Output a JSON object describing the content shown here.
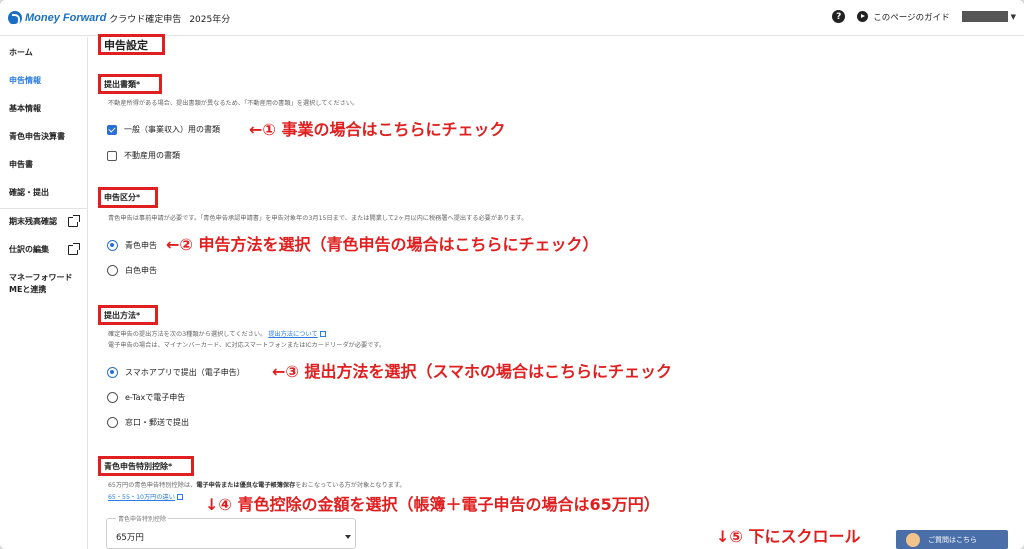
{
  "header": {
    "brand": "Money Forward",
    "product": "クラウド確定申告",
    "year": "2025年分",
    "help_icon_glyph": "?",
    "guide_label": "このページのガイド"
  },
  "sidebar": {
    "items": [
      {
        "label": "ホーム"
      },
      {
        "label": "申告情報"
      },
      {
        "label": "基本情報"
      },
      {
        "label": "青色申告決算書"
      },
      {
        "label": "申告書"
      },
      {
        "label": "確認・提出"
      },
      {
        "label": "期末残高確認"
      },
      {
        "label": "仕訳の編集"
      },
      {
        "label": "マネーフォワード\nMEと連携"
      }
    ]
  },
  "main": {
    "page_title": "申告設定",
    "sections": {
      "documents": {
        "title": "提出書類*",
        "desc": "不動産所得がある場合、提出書類が異なるため、「不動産用の書類」を選択してください。",
        "options": [
          {
            "label": "一般（事業収入）用の書類",
            "checked": true
          },
          {
            "label": "不動産用の書類",
            "checked": false
          }
        ],
        "annotation": "←① 事業の場合はこちらにチェック"
      },
      "category": {
        "title": "申告区分*",
        "desc": "青色申告は事前申請が必要です。「青色申告承認申請書」を申告対象年の3月15日まで、または開業して2ヶ月以内に税務署へ提出する必要があります。",
        "options": [
          {
            "label": "青色申告",
            "selected": true
          },
          {
            "label": "白色申告",
            "selected": false
          }
        ],
        "annotation": "←② 申告方法を選択（青色申告の場合はこちらにチェック）"
      },
      "method": {
        "title": "提出方法*",
        "desc1": "確定申告の提出方法を次の3種類から選択してください。",
        "desc1_link": "提出方法について",
        "desc2": "電子申告の場合は、マイナンバーカード、IC対応スマートフォンまたはICカードリーダが必要です。",
        "options": [
          {
            "label": "スマホアプリで提出（電子申告）",
            "selected": true
          },
          {
            "label": "e-Taxで電子申告",
            "selected": false
          },
          {
            "label": "窓口・郵送で提出",
            "selected": false
          }
        ],
        "annotation": "←③ 提出方法を選択（スマホの場合はこちらにチェック"
      },
      "deduction": {
        "title": "青色申告特別控除*",
        "desc_plain": "65万円の青色申告特別控除は、",
        "desc_bold": "電子申告または優良な電子帳簿保存",
        "desc_rest": "をおこなっている方が対象となります。",
        "link": "65・55・10万円の違い",
        "select_label": "青色申告特別控除",
        "select_value": "65万円",
        "annotation": "↓④ 青色控除の金額を選択（帳簿＋電子申告の場合は65万円）"
      }
    },
    "scroll_annotation": "↓⑤ 下にスクロール",
    "contact_label": "ご質問はこちら"
  },
  "colors": {
    "brand": "#1b6fc0",
    "annotation": "#e02020",
    "accent": "#2a6fd6",
    "active_nav": "#2a7de1"
  }
}
